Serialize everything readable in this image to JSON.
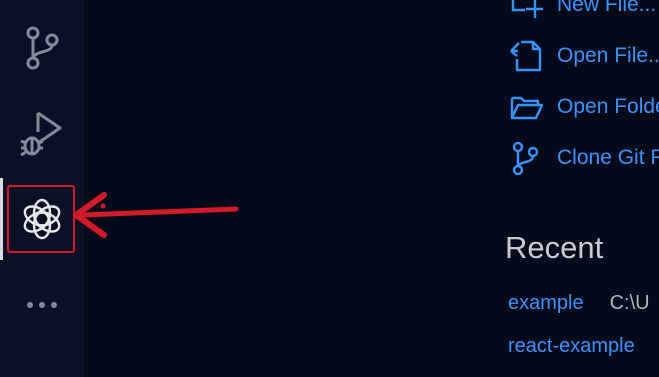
{
  "activity_bar": {
    "items": [
      {
        "icon": "source-control-icon"
      },
      {
        "icon": "run-debug-icon"
      },
      {
        "icon": "openai-chatgpt-icon",
        "active": true,
        "highlighted": true
      },
      {
        "icon": "more-icon"
      }
    ],
    "annotation_color": "#d11a2a"
  },
  "start": {
    "items": [
      {
        "label": "New File...",
        "icon": "new-file-icon"
      },
      {
        "label": "Open File...",
        "icon": "open-file-icon"
      },
      {
        "label": "Open Folder...",
        "icon": "open-folder-icon"
      },
      {
        "label": "Clone Git Repository...",
        "icon": "clone-git-icon"
      }
    ]
  },
  "recent": {
    "title": "Recent",
    "items": [
      {
        "name": "example",
        "path": "C:\\U"
      },
      {
        "name": "react-example",
        "path": ""
      }
    ]
  },
  "colors": {
    "link": "#3794ff",
    "background": "#050a1a",
    "activity_bar": "#0b1026",
    "icon": "#858a99"
  }
}
